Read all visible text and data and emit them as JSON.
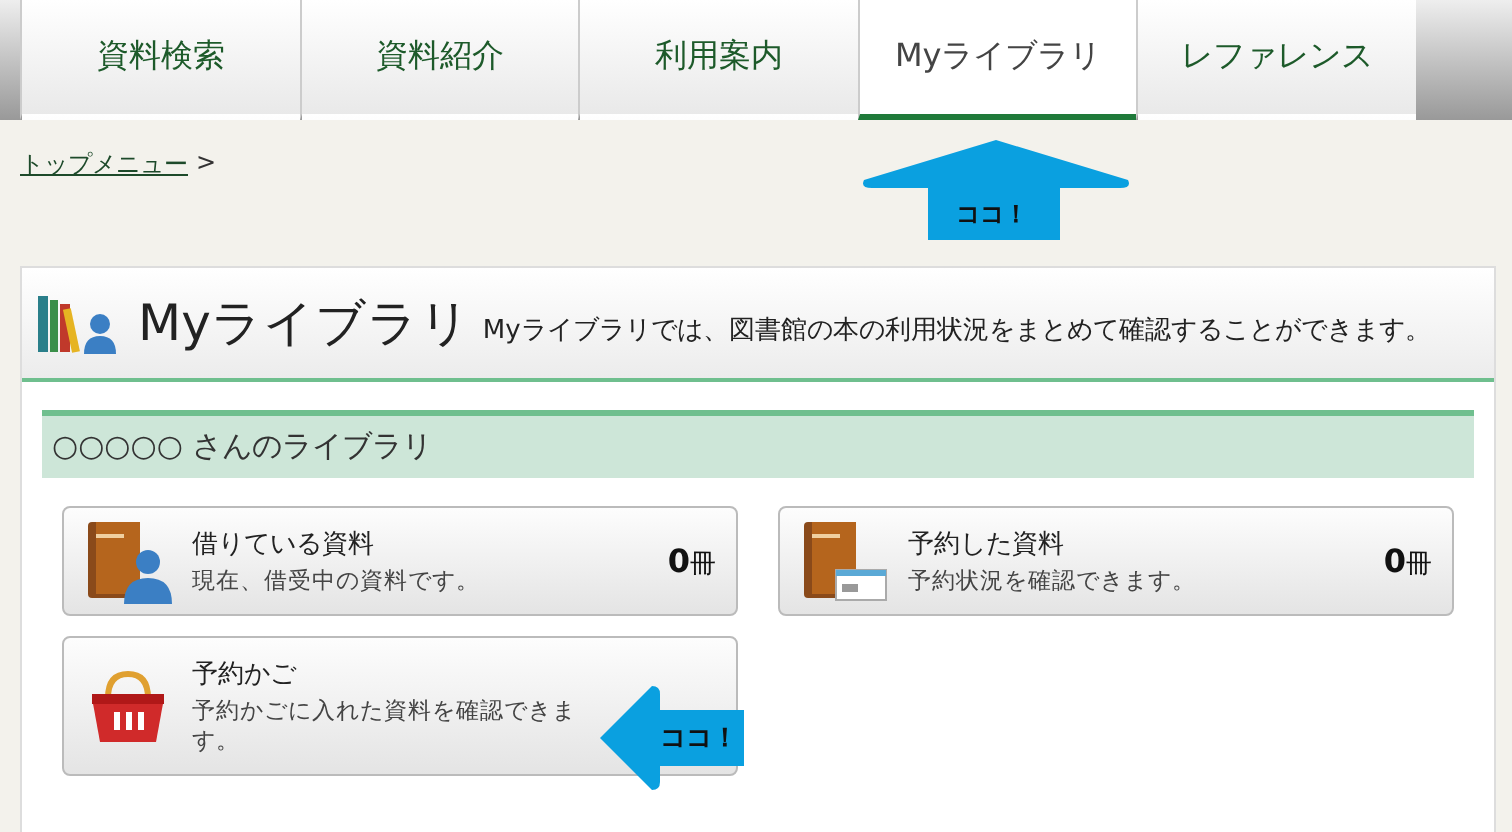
{
  "tabs": [
    {
      "label": "資料検索",
      "selected": false
    },
    {
      "label": "資料紹介",
      "selected": false
    },
    {
      "label": "利用案内",
      "selected": false
    },
    {
      "label": "Myライブラリ",
      "selected": true
    },
    {
      "label": "レファレンス",
      "selected": false
    }
  ],
  "breadcrumb": {
    "link": "トップメニュー",
    "separator": ">"
  },
  "callouts": [
    {
      "text": "ココ！",
      "kind": "up"
    },
    {
      "text": "ココ！",
      "kind": "left"
    }
  ],
  "page": {
    "title": "Myライブラリ",
    "description": "Myライブラリでは、図書館の本の利用状況をまとめて確認することができます。"
  },
  "library": {
    "heading": "○○○○○ さんのライブラリ",
    "cards": [
      {
        "kind": "loans",
        "title": "借りている資料",
        "subtitle": "現在、借受中の資料です。",
        "count": "0",
        "unit": "冊"
      },
      {
        "kind": "reservations",
        "title": "予約した資料",
        "subtitle": "予約状況を確認できます。",
        "count": "0",
        "unit": "冊"
      },
      {
        "kind": "basket",
        "title": "予約かご",
        "subtitle": "予約かごに入れた資料を確認できます。"
      }
    ]
  }
}
